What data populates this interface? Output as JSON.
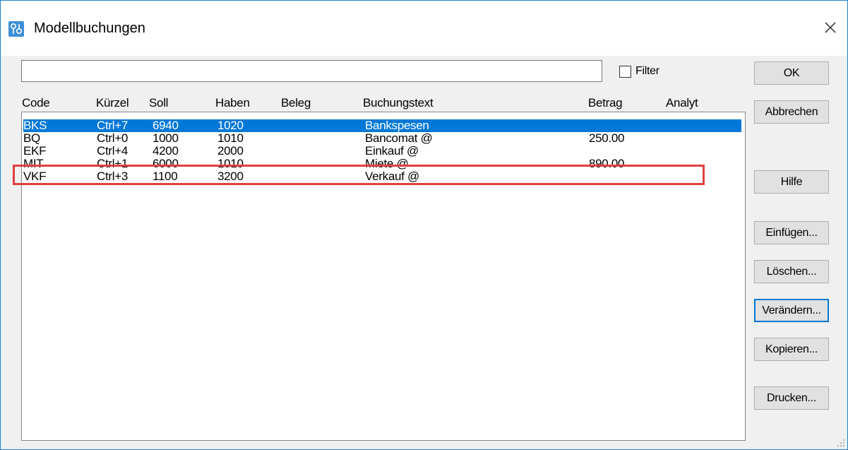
{
  "window": {
    "title": "Modellbuchungen"
  },
  "search": {
    "value": "",
    "placeholder": ""
  },
  "filter": {
    "label": "Filter",
    "checked": false
  },
  "columns": [
    "Code",
    "Kürzel",
    "Soll",
    "Haben",
    "Beleg",
    "Buchungstext",
    "Betrag",
    "Analyt"
  ],
  "rows": [
    {
      "code": "BKS",
      "kuerzel": "Ctrl+7",
      "soll": "6940",
      "haben": "1020",
      "beleg": "",
      "text": "Bankspesen",
      "betrag": "",
      "analyt": "",
      "selected": true
    },
    {
      "code": "BQ",
      "kuerzel": "Ctrl+0",
      "soll": "1000",
      "haben": "1010",
      "beleg": "",
      "text": "Bancomat @",
      "betrag": "250.00",
      "analyt": "",
      "selected": false
    },
    {
      "code": "EKF",
      "kuerzel": "Ctrl+4",
      "soll": "4200",
      "haben": "2000",
      "beleg": "",
      "text": "Einkauf @",
      "betrag": "",
      "analyt": "",
      "selected": false
    },
    {
      "code": "MIT",
      "kuerzel": "Ctrl+1",
      "soll": "6000",
      "haben": "1010",
      "beleg": "",
      "text": "Miete @",
      "betrag": "890.00",
      "analyt": "",
      "selected": false
    },
    {
      "code": "VKF",
      "kuerzel": "Ctrl+3",
      "soll": "1100",
      "haben": "3200",
      "beleg": "",
      "text": "Verkauf @",
      "betrag": "",
      "analyt": "",
      "selected": false
    }
  ],
  "buttons": {
    "ok": "OK",
    "cancel": "Abbrechen",
    "help": "Hilfe",
    "insert": "Einfügen...",
    "delete": "Löschen...",
    "change": "Verändern...",
    "copy": "Kopieren...",
    "print": "Drucken..."
  },
  "colors": {
    "selection": "#0078d7",
    "highlight_box": "#e04040",
    "accent_border": "#1883d7"
  }
}
